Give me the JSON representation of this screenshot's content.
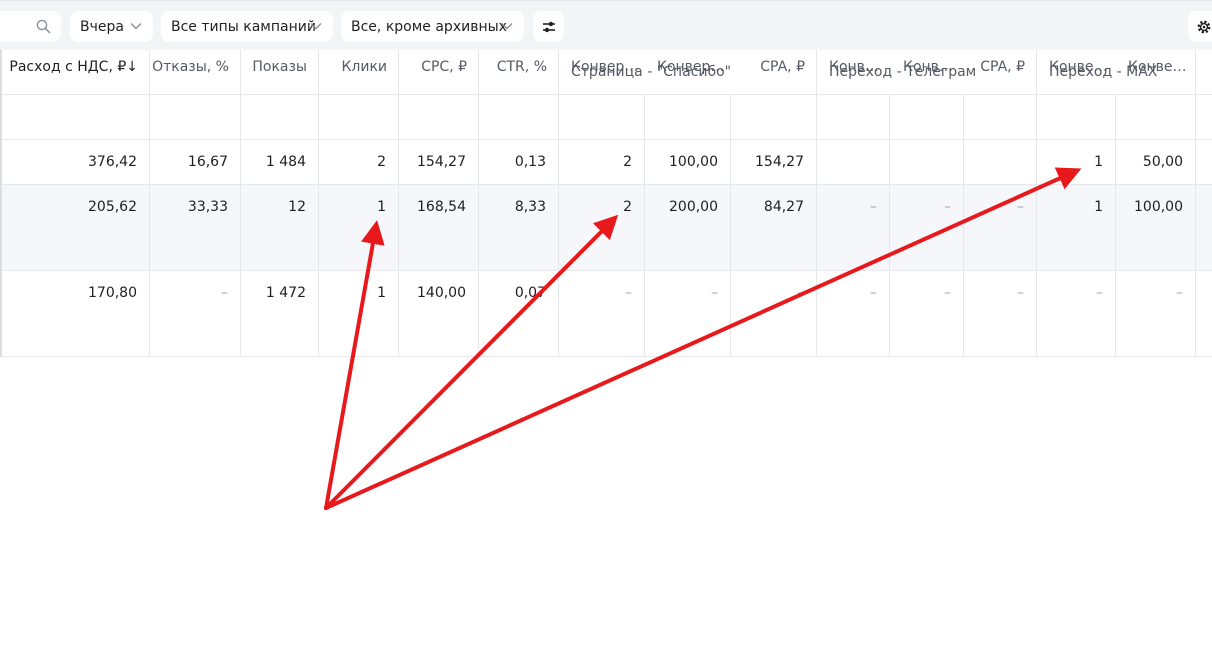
{
  "toolbar": {
    "period_label": "Вчера",
    "campaign_types_label": "Все типы кампаний",
    "status_filter_label": "Все, кроме архивных"
  },
  "groups": {
    "thanks_page": "Страница - \"Спасибо\"",
    "telegram": "Переход - Телеграм",
    "max": "Переход - MAX"
  },
  "columns": {
    "spend": "Расход с НДС, ₽↓",
    "bounces": "Отказы, %",
    "impressions": "Показы",
    "clicks": "Клики",
    "cpc": "CPC, ₽",
    "ctr": "CTR, %",
    "thanks_conv": "Конвер…",
    "thanks_conv_rate": "Конвер…",
    "thanks_cpa": "CPA, ₽",
    "tg_conv": "Конв…",
    "tg_conv_rate": "Конв…",
    "tg_cpa": "CPA, ₽",
    "max_conv": "Конве…",
    "max_conv_rate": "Конве…"
  },
  "rows": [
    {
      "spend": "376,42",
      "bounces": "16,67",
      "impressions": "1 484",
      "clicks": "2",
      "cpc": "154,27",
      "ctr": "0,13",
      "thanks_conv": "2",
      "thanks_conv_rate": "100,00",
      "thanks_cpa": "154,27",
      "tg_conv": "",
      "tg_conv_rate": "",
      "tg_cpa": "",
      "max_conv": "1",
      "max_conv_rate": "50,00"
    },
    {
      "spend": "205,62",
      "bounces": "33,33",
      "impressions": "12",
      "clicks": "1",
      "cpc": "168,54",
      "ctr": "8,33",
      "thanks_conv": "2",
      "thanks_conv_rate": "200,00",
      "thanks_cpa": "84,27",
      "tg_conv": "–",
      "tg_conv_rate": "–",
      "tg_cpa": "–",
      "max_conv": "1",
      "max_conv_rate": "100,00"
    },
    {
      "spend": "170,80",
      "bounces": "–",
      "impressions": "1 472",
      "clicks": "1",
      "cpc": "140,00",
      "ctr": "0,07",
      "thanks_conv": "–",
      "thanks_conv_rate": "–",
      "thanks_cpa": "–",
      "tg_conv": "–",
      "tg_conv_rate": "–",
      "tg_cpa": "–",
      "max_conv": "–",
      "max_conv_rate": "–"
    }
  ],
  "annotation_color": "#e8191c",
  "icons": [
    "search-icon",
    "chevron-down-icon",
    "filter-sliders-icon",
    "gear-icon"
  ]
}
